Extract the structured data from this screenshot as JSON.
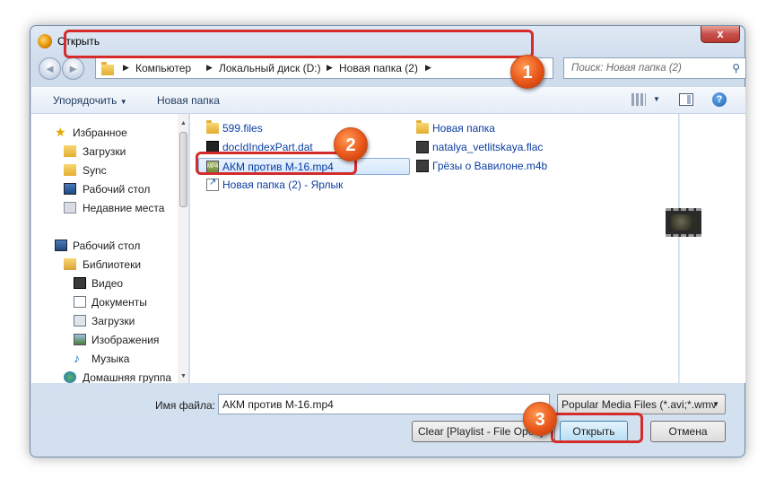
{
  "window": {
    "title": "Открыть",
    "close": "x"
  },
  "nav": {
    "back": "◄",
    "forward": "►",
    "breadcrumb": [
      "Компьютер",
      "Локальный диск (D:)",
      "Новая папка (2)"
    ],
    "search_placeholder": "Поиск: Новая папка (2)"
  },
  "toolbar": {
    "organize": "Упорядочить",
    "new_folder": "Новая папка",
    "help": "?"
  },
  "sidebar": {
    "favorites_header": "Избранное",
    "favorites": [
      "Загрузки",
      "Sync",
      "Рабочий стол",
      "Недавние места"
    ],
    "desktop_header": "Рабочий стол",
    "libraries": "Библиотеки",
    "library_items": [
      "Видео",
      "Документы",
      "Загрузки",
      "Изображения",
      "Музыка"
    ],
    "homegroup": "Домашняя группа"
  },
  "files": {
    "col1": [
      "599.files",
      "docIdIndexPart.dat",
      "АКМ против М-16.mp4",
      "Новая папка (2) - Ярлык"
    ],
    "col2": [
      "Новая папка",
      "natalya_vetlitskaya.flac",
      "Грёзы о Вавилоне.m4b"
    ],
    "selected": "АКМ против М-16.mp4"
  },
  "bottom": {
    "filename_label": "Имя файла:",
    "filename_value": "АКМ против М-16.mp4",
    "filter": "Popular Media Files (*.avi;*.wmv",
    "clear_button": "Clear [Playlist - File Open]",
    "open_button": "Открыть",
    "cancel_button": "Отмена"
  },
  "callouts": [
    "1",
    "2",
    "3"
  ]
}
